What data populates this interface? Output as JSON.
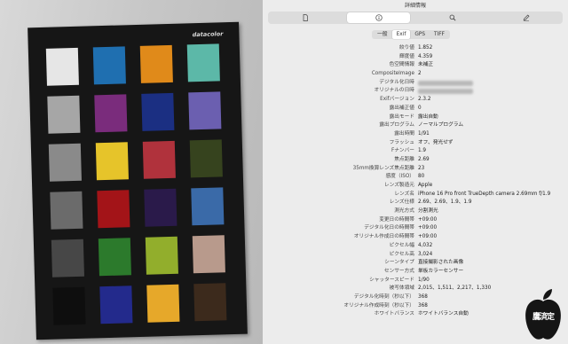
{
  "photo": {
    "brand": "datacolor",
    "patches": [
      "#e6e6e6",
      "#1f6fb0",
      "#e08a1a",
      "#5cb8a8",
      "#a6a6a6",
      "#7a2c7c",
      "#1b2f82",
      "#6b5fb0",
      "#8a8a8a",
      "#e6c42a",
      "#b0323c",
      "#36431e",
      "#6b6b6b",
      "#a31418",
      "#2a1a4a",
      "#3a6aa8",
      "#474747",
      "#2c7a2c",
      "#92ae2c",
      "#b89a8c",
      "#0e0e0e",
      "#232a8c",
      "#e6a82a",
      "#3c2a1c"
    ]
  },
  "panel": {
    "title": "詳細情報",
    "toolbar": [
      "file-icon",
      "info-icon",
      "search-icon",
      "edit-icon"
    ],
    "tabs": [
      "一般",
      "Exif",
      "GPS",
      "TIFF"
    ],
    "active_tab": "Exif",
    "rows": [
      {
        "k": "絞り値",
        "v": "1.852"
      },
      {
        "k": "輝度値",
        "v": "4.359"
      },
      {
        "k": "色空間情報",
        "v": "未補正"
      },
      {
        "k": "CompositeImage",
        "v": "2"
      },
      {
        "k": "デジタル化日時",
        "v": ""
      },
      {
        "k": "オリジナルの日時",
        "v": ""
      },
      {
        "k": "Exifバージョン",
        "v": "2.3.2"
      },
      {
        "k": "露出補正値",
        "v": "0"
      },
      {
        "k": "露出モード",
        "v": "露出自動"
      },
      {
        "k": "露出プログラム",
        "v": "ノーマルプログラム"
      },
      {
        "k": "露出時間",
        "v": "1/91"
      },
      {
        "k": "フラッシュ",
        "v": "オフ、発光せず"
      },
      {
        "k": "Fナンバー",
        "v": "1.9"
      },
      {
        "k": "焦点距離",
        "v": "2.69"
      },
      {
        "k": "35mm換算レンズ焦点距離",
        "v": "23"
      },
      {
        "k": "感度（ISO）",
        "v": "80"
      },
      {
        "k": "レンズ製造元",
        "v": "Apple"
      },
      {
        "k": "レンズ名",
        "v": "iPhone 16 Pro front TrueDepth camera 2.69mm f/1.9"
      },
      {
        "k": "レンズ仕様",
        "v": "2.69、2.69、1.9、1.9"
      },
      {
        "k": "測光方式",
        "v": "分割測光"
      },
      {
        "k": "変更日の時間帯",
        "v": "+09:00"
      },
      {
        "k": "デジタル化日の時間帯",
        "v": "+09:00"
      },
      {
        "k": "オリジナル作成日の時間帯",
        "v": "+09:00"
      },
      {
        "k": "ピクセル幅",
        "v": "4,032"
      },
      {
        "k": "ピクセル高",
        "v": "3,024"
      },
      {
        "k": "シーンタイプ",
        "v": "直接撮影された画像"
      },
      {
        "k": "センサー方式",
        "v": "単板カラーセンサー"
      },
      {
        "k": "シャッタースピード",
        "v": "1/90"
      },
      {
        "k": "被写体領域",
        "v": "2,015、1,511、2,217、1,330"
      },
      {
        "k": "デジタル化時刻（秒以下）",
        "v": "368"
      },
      {
        "k": "オリジナル作成時刻（秒以下）",
        "v": "368"
      },
      {
        "k": "ホワイトバランス",
        "v": "ホワイトバランス自動"
      }
    ]
  },
  "watermark": {
    "text": "鷹済定"
  }
}
